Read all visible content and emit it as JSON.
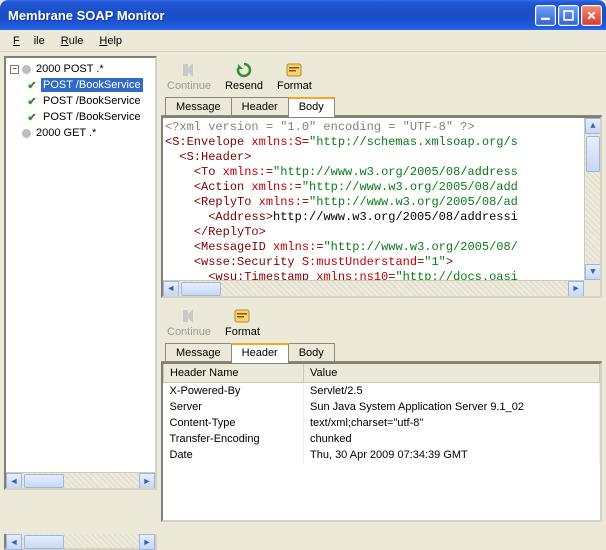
{
  "window": {
    "title": "Membrane SOAP Monitor"
  },
  "menu": {
    "file": "File",
    "rule": "Rule",
    "help": "Help"
  },
  "tree": {
    "nodes": [
      {
        "label": "2000 POST .*",
        "children": [
          {
            "label": "POST /BookService",
            "selected": true
          },
          {
            "label": "POST /BookService"
          },
          {
            "label": "POST /BookService"
          }
        ]
      },
      {
        "label": "2000 GET .*"
      }
    ]
  },
  "top_pane": {
    "tools": {
      "continue": "Continue",
      "resend": "Resend",
      "format": "Format"
    },
    "tabs": {
      "message": "Message",
      "header": "Header",
      "body": "Body",
      "active": "body"
    },
    "xml_lines": [
      {
        "prefix": "",
        "segs": [
          {
            "c": "decl",
            "t": "<?xml version = \"1.0\" encoding = \"UTF-8\" ?>"
          }
        ]
      },
      {
        "prefix": "",
        "segs": [
          {
            "c": "tag",
            "t": "<S:Envelope "
          },
          {
            "c": "attr",
            "t": "xmlns:S"
          },
          {
            "c": "tag",
            "t": "="
          },
          {
            "c": "str",
            "t": "\"http://schemas.xmlsoap.org/s"
          }
        ]
      },
      {
        "prefix": "  ",
        "segs": [
          {
            "c": "tag",
            "t": "<S:Header>"
          }
        ]
      },
      {
        "prefix": "    ",
        "segs": [
          {
            "c": "tag",
            "t": "<To "
          },
          {
            "c": "attr",
            "t": "xmlns:"
          },
          {
            "c": "tag",
            "t": "="
          },
          {
            "c": "str",
            "t": "\"http://www.w3.org/2005/08/address"
          }
        ]
      },
      {
        "prefix": "    ",
        "segs": [
          {
            "c": "tag",
            "t": "<Action "
          },
          {
            "c": "attr",
            "t": "xmlns:"
          },
          {
            "c": "tag",
            "t": "="
          },
          {
            "c": "str",
            "t": "\"http://www.w3.org/2005/08/add"
          }
        ]
      },
      {
        "prefix": "    ",
        "segs": [
          {
            "c": "tag",
            "t": "<ReplyTo "
          },
          {
            "c": "attr",
            "t": "xmlns:"
          },
          {
            "c": "tag",
            "t": "="
          },
          {
            "c": "str",
            "t": "\"http://www.w3.org/2005/08/ad"
          }
        ]
      },
      {
        "prefix": "      ",
        "segs": [
          {
            "c": "tag",
            "t": "<Address>"
          },
          {
            "c": "text",
            "t": "http://www.w3.org/2005/08/addressi"
          }
        ]
      },
      {
        "prefix": "    ",
        "segs": [
          {
            "c": "tag",
            "t": "</ReplyTo>"
          }
        ]
      },
      {
        "prefix": "    ",
        "segs": [
          {
            "c": "tag",
            "t": "<MessageID "
          },
          {
            "c": "attr",
            "t": "xmlns:"
          },
          {
            "c": "tag",
            "t": "="
          },
          {
            "c": "str",
            "t": "\"http://www.w3.org/2005/08/"
          }
        ]
      },
      {
        "prefix": "    ",
        "segs": [
          {
            "c": "tag",
            "t": "<wsse:Security "
          },
          {
            "c": "attr",
            "t": "S:mustUnderstand"
          },
          {
            "c": "tag",
            "t": "="
          },
          {
            "c": "str",
            "t": "\"1\""
          },
          {
            "c": "tag",
            "t": ">"
          }
        ]
      },
      {
        "prefix": "      ",
        "segs": [
          {
            "c": "tag",
            "t": "<wsu:Timestamp "
          },
          {
            "c": "attr",
            "t": "xmlns:ns10"
          },
          {
            "c": "tag",
            "t": "="
          },
          {
            "c": "str",
            "t": "\"http://docs.oasi"
          }
        ]
      }
    ]
  },
  "bottom_pane": {
    "tools": {
      "continue": "Continue",
      "format": "Format"
    },
    "tabs": {
      "message": "Message",
      "header": "Header",
      "body": "Body",
      "active": "header"
    },
    "columns": {
      "name": "Header Name",
      "value": "Value"
    },
    "rows": [
      {
        "name": "X-Powered-By",
        "value": "Servlet/2.5"
      },
      {
        "name": "Server",
        "value": "Sun Java System Application Server 9.1_02"
      },
      {
        "name": "Content-Type",
        "value": "text/xml;charset=\"utf-8\""
      },
      {
        "name": "Transfer-Encoding",
        "value": "chunked"
      },
      {
        "name": "Date",
        "value": "Thu, 30 Apr 2009 07:34:39 GMT"
      }
    ]
  }
}
